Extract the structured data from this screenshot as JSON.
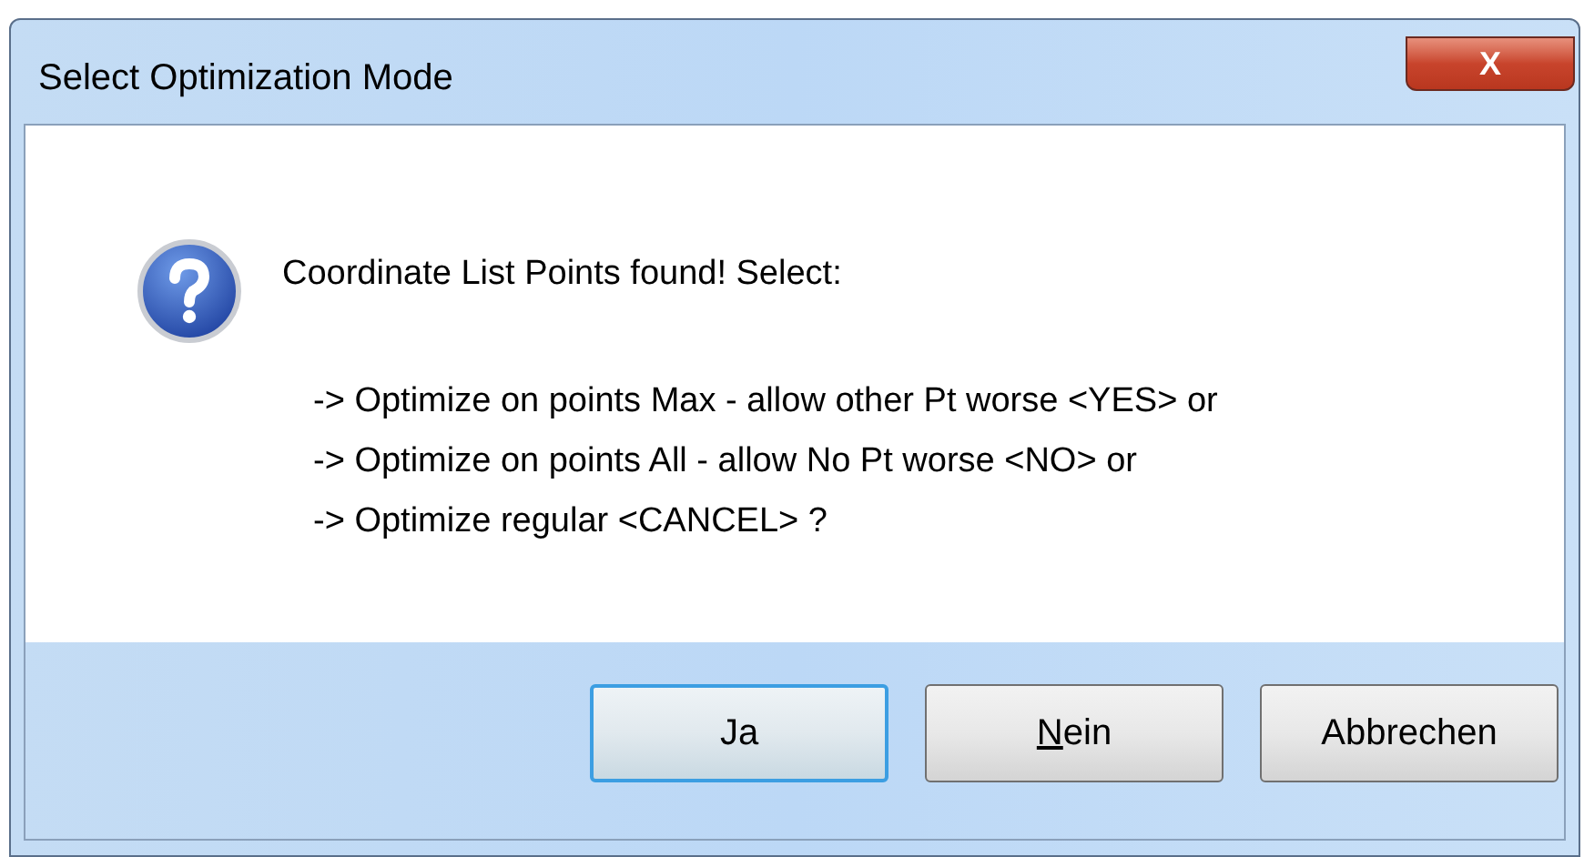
{
  "window": {
    "title": "Select Optimization Mode",
    "close_button": "X"
  },
  "message": {
    "heading": "Coordinate List Points found! Select:",
    "lines": [
      "-> Optimize on points Max - allow other Pt worse <YES> or",
      "-> Optimize on points All - allow No Pt worse <NO> or",
      "-> Optimize regular <CANCEL> ?"
    ]
  },
  "buttons": [
    {
      "label": "Ja",
      "default": true,
      "mnemonic_underlined": false
    },
    {
      "label": "Nein",
      "default": false,
      "mnemonic_underlined": true
    },
    {
      "label": "Abbrechen",
      "default": false,
      "mnemonic_underlined": false
    }
  ]
}
